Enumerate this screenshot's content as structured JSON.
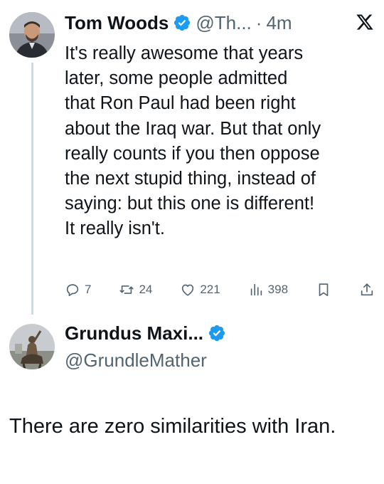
{
  "tweet": {
    "author_name": "Tom Woods",
    "handle": "@Th...",
    "separator": "·",
    "time": "4m",
    "text": "It's really awesome that years\nlater, some people admitted\nthat Ron Paul had been right\nabout the Iraq war. But that only\nreally counts if you then oppose\nthe next stupid thing, instead of\nsaying: but this one is different!\nIt really isn't.",
    "stats": {
      "replies": "7",
      "retweets": "24",
      "likes": "221",
      "views": "398"
    }
  },
  "reply": {
    "author_name": "Grundus Maxi...",
    "handle": "@GrundleMather",
    "text": "There are zero similarities with Iran."
  },
  "icons": {
    "verified": "verified-badge-icon",
    "brand": "x-logo-icon",
    "reply": "reply-icon",
    "retweet": "retweet-icon",
    "like": "heart-icon",
    "views": "views-icon",
    "bookmark": "bookmark-icon",
    "share": "share-icon"
  },
  "colors": {
    "verified": "#1d9bf0",
    "text": "#0f1419",
    "secondary": "#536471",
    "thread_line": "#cfd9de"
  }
}
